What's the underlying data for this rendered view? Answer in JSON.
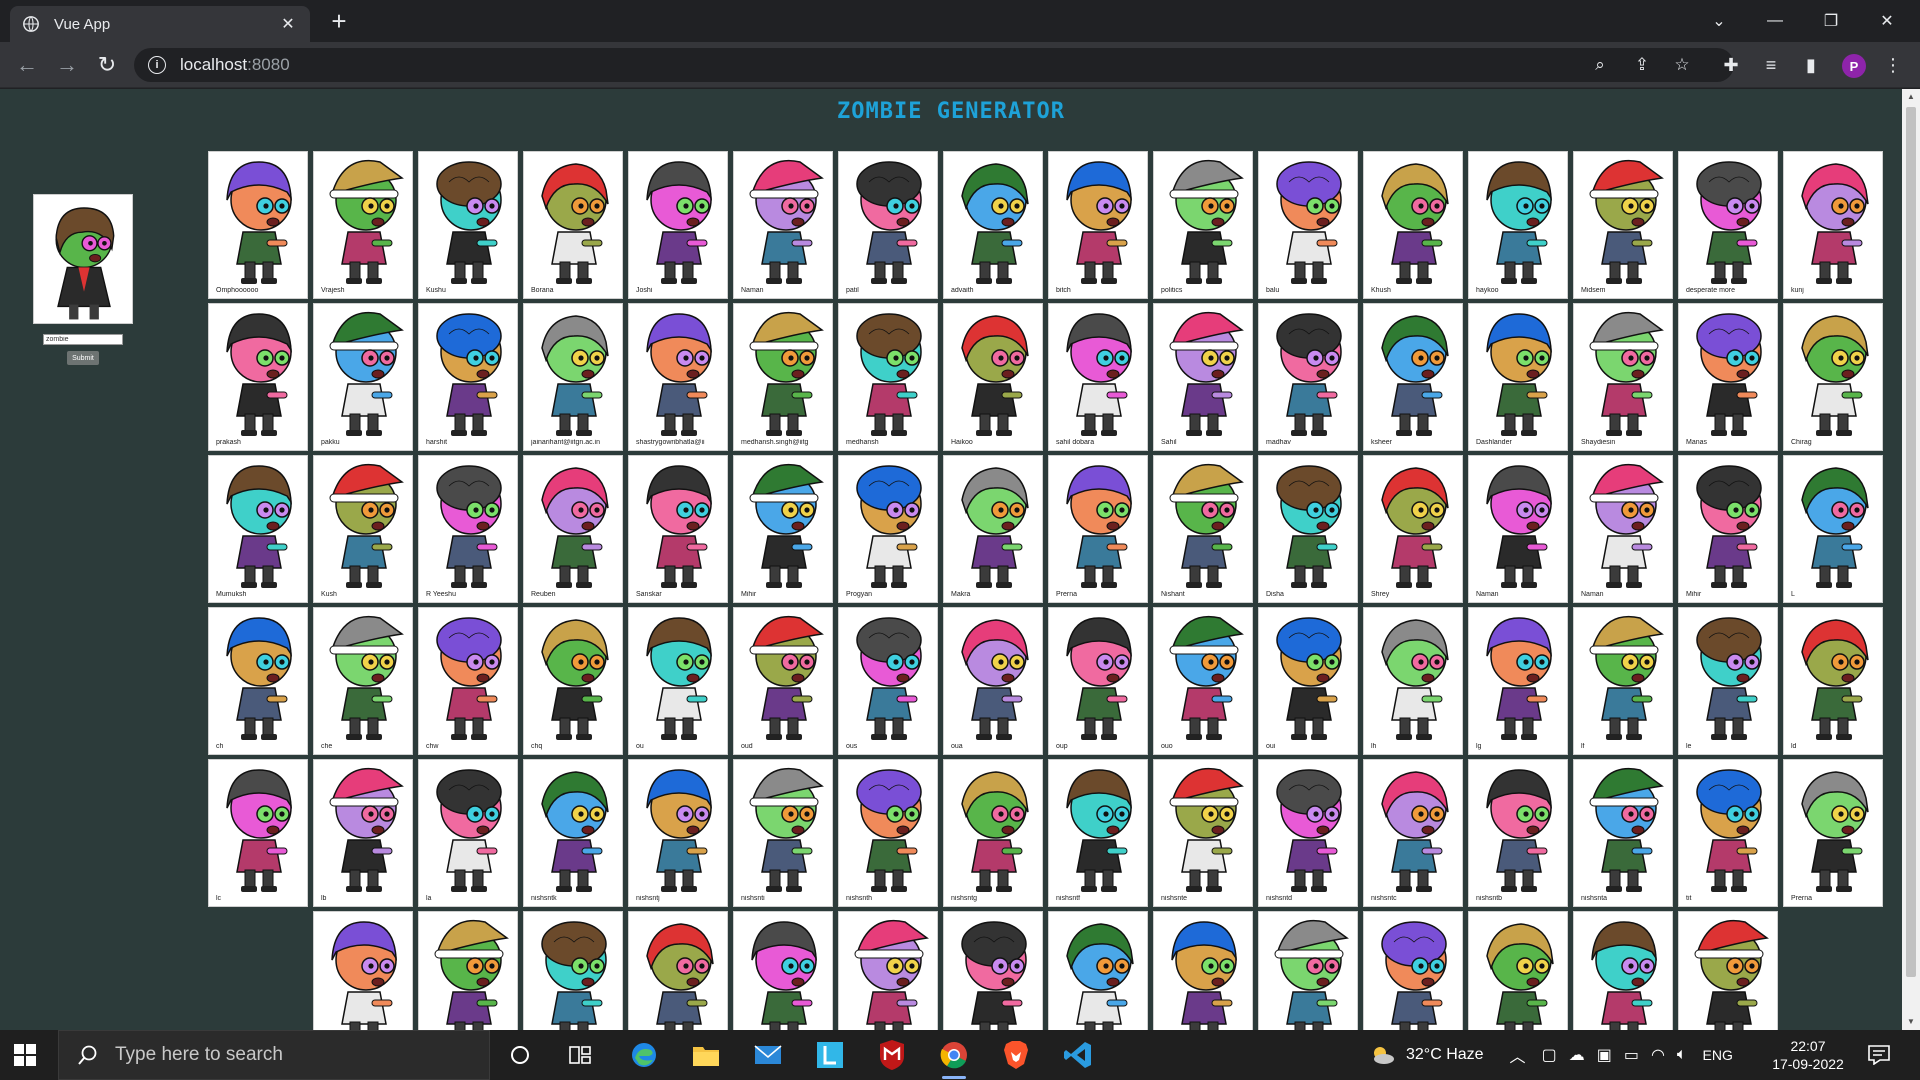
{
  "browser": {
    "tab_title": "Vue App",
    "url_host": "localhost",
    "url_port": ":8080",
    "profile_initial": "P"
  },
  "page": {
    "title": "ZOMBIE GENERATOR",
    "input_value": "zombie",
    "submit_label": "Submit"
  },
  "cards": [
    "Omphoooooo",
    "Vrajesh",
    "Kushu",
    "Borana",
    "Joshi",
    "Naman",
    "patil",
    "advaith",
    "bitch",
    "politics",
    "balu",
    "Khush",
    "haykoo",
    "Midsem",
    "desperate more",
    "kunj",
    "prakash",
    "pakku",
    "harshit",
    "jainarihant@iitgn.ac.in",
    "shastrygowribhatla@ii",
    "medhansh.singh@iitg",
    "medhansh",
    "Haikoo",
    "sahil dobara",
    "Sahil",
    "madhav",
    "ksheer",
    "Dashlander",
    "Shaydiesin",
    "Manas",
    "Chirag",
    "Mumuksh",
    "Kush",
    "R Yeeshu",
    "Reuben",
    "Sanskar",
    "Mihir",
    "Progyan",
    "Makra",
    "Prerna",
    "Nishant",
    "Disha",
    "Shrey",
    "Naman",
    "Naman",
    "Mihir",
    "L",
    "ch",
    "che",
    "chw",
    "chq",
    "ou",
    "oud",
    "ous",
    "oua",
    "oup",
    "ouo",
    "oui",
    "lh",
    "lg",
    "lf",
    "le",
    "ld",
    "lc",
    "lb",
    "la",
    "nishsntk",
    "nishsntj",
    "nishsnti",
    "nishsnth",
    "nishsntg",
    "nishsntf",
    "nishsnte",
    "nishsntd",
    "nishsntc",
    "nishsntb",
    "nishsnta",
    "tit",
    "Prerna",
    "",
    "",
    "",
    "",
    "",
    "",
    "",
    "",
    "",
    "",
    "",
    "",
    "",
    ""
  ],
  "taskbar": {
    "search_placeholder": "Type here to search",
    "weather": "32°C  Haze",
    "language": "ENG",
    "time": "22:07",
    "date": "17-09-2022"
  },
  "colors": {
    "page_bg": "#2c3b3a",
    "title": "#1ea2d8"
  }
}
